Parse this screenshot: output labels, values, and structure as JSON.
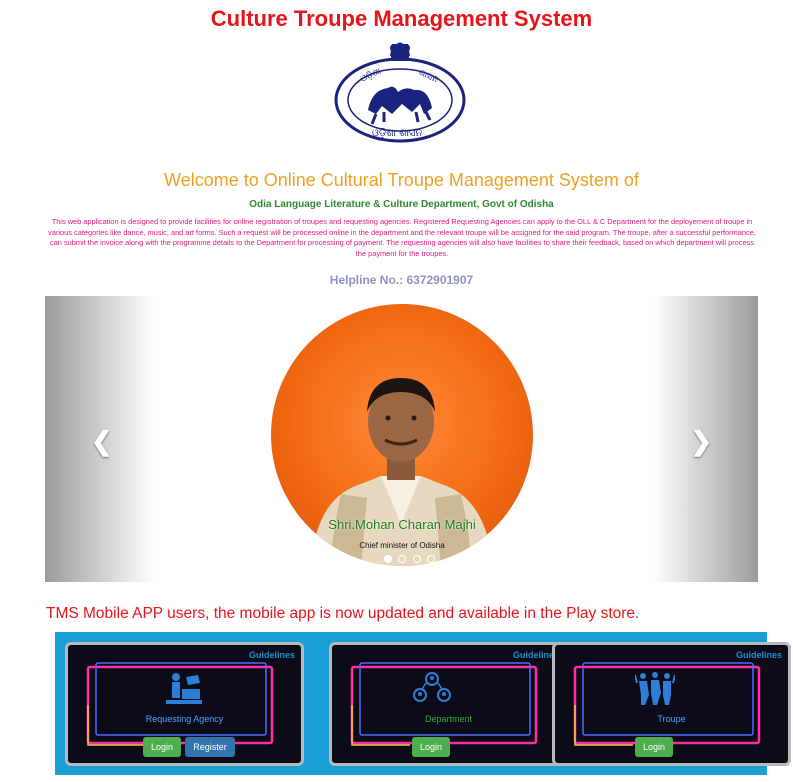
{
  "header": {
    "title": "Culture Troupe Management System"
  },
  "intro": {
    "welcome": "Welcome to Online Cultural Troupe Management System of",
    "department": "Odia Language Literature & Culture Department, Govt of Odisha",
    "description": "This web application is designed to provide facilities for online registration of troupes and requesting agencies. Registered Requesting Agencies can apply to the OLL & C Department for the deployement of troupe in various categories like dance, music, and art forms. Such a request will be processed online in the department and the relevant troupe will be assigned for the said program. The troupe, after a successful performance, can submit the invoice along with the programme details to the Department for processing of payment. The requesting agencies will also have facilities to share their feedback, based on which department will process the payment for the troupes.",
    "helpline": "Helpline No.: 6372901907"
  },
  "carousel": {
    "caption_name": "Shri.Mohan Charan Majhi",
    "caption_role": "Chief minister of Odisha",
    "prev_icon": "chevron-left-icon",
    "next_icon": "chevron-right-icon",
    "active_slide": 1,
    "slide_count": 4
  },
  "notice": {
    "text": "TMS Mobile APP users, the mobile app is now updated and available in the Play store."
  },
  "cards": [
    {
      "guidelines": "Guidelines",
      "icon": "agency-icon",
      "label": "Requesting Agency",
      "login": "Login",
      "register": "Register"
    },
    {
      "guidelines": "Guidelines",
      "icon": "department-icon",
      "label": "Department",
      "login": "Login"
    },
    {
      "guidelines": "Guidelines",
      "icon": "troupe-icon",
      "label": "Troupe",
      "login": "Login"
    }
  ],
  "colors": {
    "title": "#e8141b",
    "welcome": "#f0a020",
    "department": "#2e8b2e",
    "description": "#e6177d",
    "helpline": "#9092c6",
    "card_panel": "#1a9fd6",
    "login_button": "#4cae4c",
    "register_button": "#3174b0"
  }
}
